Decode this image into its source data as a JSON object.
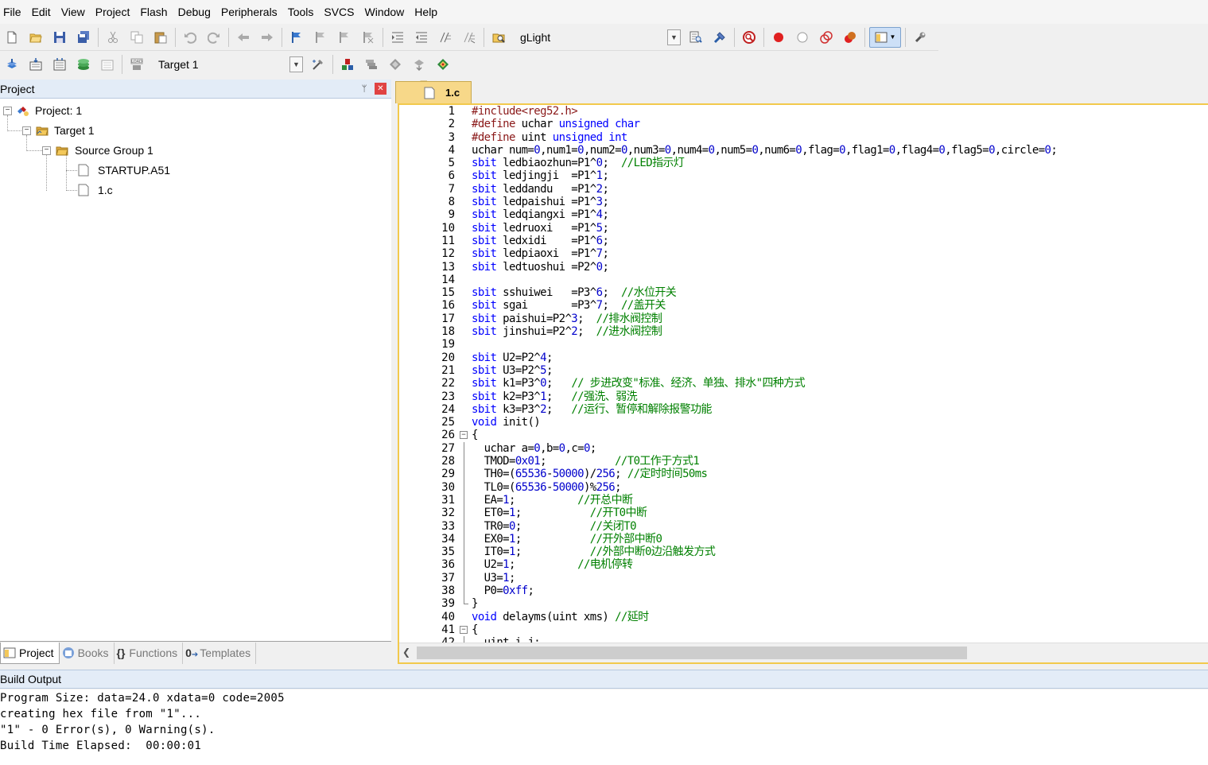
{
  "menu": [
    "File",
    "Edit",
    "View",
    "Project",
    "Flash",
    "Debug",
    "Peripherals",
    "Tools",
    "SVCS",
    "Window",
    "Help"
  ],
  "toolbar1": {
    "icons": [
      "new-file-icon",
      "open-folder-icon",
      "save-icon",
      "save-all-icon",
      "cut-icon",
      "copy-icon",
      "paste-icon",
      "undo-icon",
      "redo-icon",
      "navigate-back-icon",
      "navigate-forward-icon",
      "bookmark-insert-icon",
      "bookmark-prev-icon",
      "bookmark-next-icon",
      "bookmark-clear-icon",
      "indent-icon",
      "unindent-icon",
      "comment-icon",
      "uncomment-icon",
      "find-in-files-icon"
    ],
    "find_text": "gLight",
    "right_icons": [
      "find-icon",
      "incremental-find-icon",
      "debug-session-icon",
      "breakpoint-insert-icon",
      "breakpoint-disable-icon",
      "breakpoint-disable-all-icon",
      "breakpoint-kill-all-icon",
      "window-layout-icon",
      "configure-icon"
    ]
  },
  "toolbar2": {
    "icons": [
      "translate-icon",
      "build-icon",
      "rebuild-icon",
      "batch-build-icon",
      "stop-build-icon",
      "download-icon"
    ],
    "target": "Target 1",
    "right_icons": [
      "target-options-icon",
      "manage-components-icon",
      "file-extensions-icon",
      "select-packs-icon",
      "pack-installer-icon",
      "run-time-environment-icon"
    ]
  },
  "project_panel": {
    "title": "Project",
    "tree": {
      "project": "Project: 1",
      "target": "Target 1",
      "group": "Source Group 1",
      "files": [
        "STARTUP.A51",
        "1.c"
      ]
    },
    "tabs": [
      "Project",
      "Books",
      "Functions",
      "Templates"
    ]
  },
  "editor": {
    "active_tab": "1.c",
    "lines": [
      {
        "n": "1",
        "segs": [
          [
            "pp",
            "#include<reg52.h>"
          ]
        ]
      },
      {
        "n": "2",
        "segs": [
          [
            "pp",
            "#define"
          ],
          [
            "",
            " uchar "
          ],
          [
            "kw",
            "unsigned char"
          ]
        ]
      },
      {
        "n": "3",
        "segs": [
          [
            "pp",
            "#define"
          ],
          [
            "",
            " uint "
          ],
          [
            "kw",
            "unsigned int"
          ]
        ]
      },
      {
        "n": "4",
        "segs": [
          [
            "",
            "uchar num="
          ],
          [
            "num",
            "0"
          ],
          [
            "",
            ",num1="
          ],
          [
            "num",
            "0"
          ],
          [
            "",
            ",num2="
          ],
          [
            "num",
            "0"
          ],
          [
            "",
            ",num3="
          ],
          [
            "num",
            "0"
          ],
          [
            "",
            ",num4="
          ],
          [
            "num",
            "0"
          ],
          [
            "",
            ",num5="
          ],
          [
            "num",
            "0"
          ],
          [
            "",
            ",num6="
          ],
          [
            "num",
            "0"
          ],
          [
            "",
            ",flag="
          ],
          [
            "num",
            "0"
          ],
          [
            "",
            ",flag1="
          ],
          [
            "num",
            "0"
          ],
          [
            "",
            ",flag4="
          ],
          [
            "num",
            "0"
          ],
          [
            "",
            ",flag5="
          ],
          [
            "num",
            "0"
          ],
          [
            "",
            ",circle="
          ],
          [
            "num",
            "0"
          ],
          [
            "",
            ";"
          ]
        ]
      },
      {
        "n": "5",
        "segs": [
          [
            "kw",
            "sbit"
          ],
          [
            "",
            " ledbiaozhun=P1^"
          ],
          [
            "num",
            "0"
          ],
          [
            "",
            ";  "
          ],
          [
            "cm",
            "//LED指示灯"
          ]
        ]
      },
      {
        "n": "6",
        "segs": [
          [
            "kw",
            "sbit"
          ],
          [
            "",
            " ledjingji  =P1^"
          ],
          [
            "num",
            "1"
          ],
          [
            "",
            ";"
          ]
        ]
      },
      {
        "n": "7",
        "segs": [
          [
            "kw",
            "sbit"
          ],
          [
            "",
            " leddandu   =P1^"
          ],
          [
            "num",
            "2"
          ],
          [
            "",
            ";"
          ]
        ]
      },
      {
        "n": "8",
        "segs": [
          [
            "kw",
            "sbit"
          ],
          [
            "",
            " ledpaishui =P1^"
          ],
          [
            "num",
            "3"
          ],
          [
            "",
            ";"
          ]
        ]
      },
      {
        "n": "9",
        "segs": [
          [
            "kw",
            "sbit"
          ],
          [
            "",
            " ledqiangxi =P1^"
          ],
          [
            "num",
            "4"
          ],
          [
            "",
            ";"
          ]
        ]
      },
      {
        "n": "10",
        "segs": [
          [
            "kw",
            "sbit"
          ],
          [
            "",
            " ledruoxi   =P1^"
          ],
          [
            "num",
            "5"
          ],
          [
            "",
            ";"
          ]
        ]
      },
      {
        "n": "11",
        "segs": [
          [
            "kw",
            "sbit"
          ],
          [
            "",
            " ledxidi    =P1^"
          ],
          [
            "num",
            "6"
          ],
          [
            "",
            ";"
          ]
        ]
      },
      {
        "n": "12",
        "segs": [
          [
            "kw",
            "sbit"
          ],
          [
            "",
            " ledpiaoxi  =P1^"
          ],
          [
            "num",
            "7"
          ],
          [
            "",
            ";"
          ]
        ]
      },
      {
        "n": "13",
        "segs": [
          [
            "kw",
            "sbit"
          ],
          [
            "",
            " ledtuoshui =P2^"
          ],
          [
            "num",
            "0"
          ],
          [
            "",
            ";"
          ]
        ]
      },
      {
        "n": "14",
        "segs": []
      },
      {
        "n": "15",
        "segs": [
          [
            "kw",
            "sbit"
          ],
          [
            "",
            " sshuiwei   =P3^"
          ],
          [
            "num",
            "6"
          ],
          [
            "",
            ";  "
          ],
          [
            "cm",
            "//水位开关"
          ]
        ]
      },
      {
        "n": "16",
        "segs": [
          [
            "kw",
            "sbit"
          ],
          [
            "",
            " sgai       =P3^"
          ],
          [
            "num",
            "7"
          ],
          [
            "",
            ";  "
          ],
          [
            "cm",
            "//盖开关"
          ]
        ]
      },
      {
        "n": "17",
        "segs": [
          [
            "kw",
            "sbit"
          ],
          [
            "",
            " paishui=P2^"
          ],
          [
            "num",
            "3"
          ],
          [
            "",
            ";  "
          ],
          [
            "cm",
            "//排水阀控制"
          ]
        ]
      },
      {
        "n": "18",
        "segs": [
          [
            "kw",
            "sbit"
          ],
          [
            "",
            " jinshui=P2^"
          ],
          [
            "num",
            "2"
          ],
          [
            "",
            ";  "
          ],
          [
            "cm",
            "//进水阀控制"
          ]
        ]
      },
      {
        "n": "19",
        "segs": []
      },
      {
        "n": "20",
        "segs": [
          [
            "kw",
            "sbit"
          ],
          [
            "",
            " U2=P2^"
          ],
          [
            "num",
            "4"
          ],
          [
            "",
            ";"
          ]
        ]
      },
      {
        "n": "21",
        "segs": [
          [
            "kw",
            "sbit"
          ],
          [
            "",
            " U3=P2^"
          ],
          [
            "num",
            "5"
          ],
          [
            "",
            ";"
          ]
        ]
      },
      {
        "n": "22",
        "segs": [
          [
            "kw",
            "sbit"
          ],
          [
            "",
            " k1=P3^"
          ],
          [
            "num",
            "0"
          ],
          [
            "",
            ";   "
          ],
          [
            "cm",
            "// 步进改变\"标准、经济、单独、排水\"四种方式"
          ]
        ]
      },
      {
        "n": "23",
        "segs": [
          [
            "kw",
            "sbit"
          ],
          [
            "",
            " k2=P3^"
          ],
          [
            "num",
            "1"
          ],
          [
            "",
            ";   "
          ],
          [
            "cm",
            "//强洗、弱洗"
          ]
        ]
      },
      {
        "n": "24",
        "segs": [
          [
            "kw",
            "sbit"
          ],
          [
            "",
            " k3=P3^"
          ],
          [
            "num",
            "2"
          ],
          [
            "",
            ";   "
          ],
          [
            "cm",
            "//运行、暂停和解除报警功能"
          ]
        ]
      },
      {
        "n": "25",
        "segs": [
          [
            "kw",
            "void"
          ],
          [
            "",
            " init()"
          ]
        ]
      },
      {
        "n": "26",
        "fold": "open",
        "segs": [
          [
            "",
            "{"
          ]
        ]
      },
      {
        "n": "27",
        "segs": [
          [
            "",
            "  uchar a="
          ],
          [
            "num",
            "0"
          ],
          [
            "",
            ",b="
          ],
          [
            "num",
            "0"
          ],
          [
            "",
            ",c="
          ],
          [
            "num",
            "0"
          ],
          [
            "",
            ";"
          ]
        ]
      },
      {
        "n": "28",
        "segs": [
          [
            "",
            "  TMOD="
          ],
          [
            "num",
            "0x01"
          ],
          [
            "",
            ";           "
          ],
          [
            "cm",
            "//T0工作于方式1"
          ]
        ]
      },
      {
        "n": "29",
        "segs": [
          [
            "",
            "  TH0=("
          ],
          [
            "num",
            "65536"
          ],
          [
            "",
            "-"
          ],
          [
            "num",
            "50000"
          ],
          [
            "",
            ")/"
          ],
          [
            "num",
            "256"
          ],
          [
            "",
            "; "
          ],
          [
            "cm",
            "//定时时间50ms"
          ]
        ]
      },
      {
        "n": "30",
        "segs": [
          [
            "",
            "  TL0=("
          ],
          [
            "num",
            "65536"
          ],
          [
            "",
            "-"
          ],
          [
            "num",
            "50000"
          ],
          [
            "",
            ")%"
          ],
          [
            "num",
            "256"
          ],
          [
            "",
            ";"
          ]
        ]
      },
      {
        "n": "31",
        "segs": [
          [
            "",
            "  EA="
          ],
          [
            "num",
            "1"
          ],
          [
            "",
            ";          "
          ],
          [
            "cm",
            "//开总中断"
          ]
        ]
      },
      {
        "n": "32",
        "segs": [
          [
            "",
            "  ET0="
          ],
          [
            "num",
            "1"
          ],
          [
            "",
            ";           "
          ],
          [
            "cm",
            "//开T0中断"
          ]
        ]
      },
      {
        "n": "33",
        "segs": [
          [
            "",
            "  TR0="
          ],
          [
            "num",
            "0"
          ],
          [
            "",
            ";           "
          ],
          [
            "cm",
            "//关闭T0"
          ]
        ]
      },
      {
        "n": "34",
        "segs": [
          [
            "",
            "  EX0="
          ],
          [
            "num",
            "1"
          ],
          [
            "",
            ";           "
          ],
          [
            "cm",
            "//开外部中断0"
          ]
        ]
      },
      {
        "n": "35",
        "segs": [
          [
            "",
            "  IT0="
          ],
          [
            "num",
            "1"
          ],
          [
            "",
            ";           "
          ],
          [
            "cm",
            "//外部中断0边沿触发方式"
          ]
        ]
      },
      {
        "n": "36",
        "segs": [
          [
            "",
            "  U2="
          ],
          [
            "num",
            "1"
          ],
          [
            "",
            ";          "
          ],
          [
            "cm",
            "//电机停转"
          ]
        ]
      },
      {
        "n": "37",
        "segs": [
          [
            "",
            "  U3="
          ],
          [
            "num",
            "1"
          ],
          [
            "",
            ";"
          ]
        ]
      },
      {
        "n": "38",
        "segs": [
          [
            "",
            "  P0="
          ],
          [
            "num",
            "0xff"
          ],
          [
            "",
            ";"
          ]
        ]
      },
      {
        "n": "39",
        "fold": "end",
        "segs": [
          [
            "",
            "}"
          ]
        ]
      },
      {
        "n": "40",
        "segs": [
          [
            "kw",
            "void"
          ],
          [
            "",
            " delayms(uint xms) "
          ],
          [
            "cm",
            "//延时"
          ]
        ]
      },
      {
        "n": "41",
        "fold": "open",
        "segs": [
          [
            "",
            "{"
          ]
        ]
      },
      {
        "n": "42",
        "segs": [
          [
            "",
            "  uint i,j;"
          ]
        ]
      }
    ]
  },
  "build_output": {
    "title": "Build Output",
    "lines": [
      "Program Size: data=24.0 xdata=0 code=2005",
      "creating hex file from \"1\"...",
      "\"1\" - 0 Error(s), 0 Warning(s).",
      "Build Time Elapsed:  00:00:01"
    ]
  }
}
